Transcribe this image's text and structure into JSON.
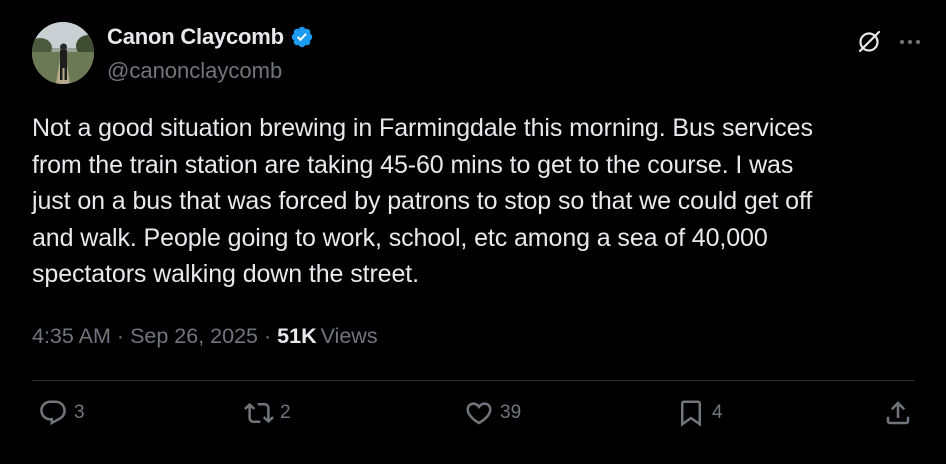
{
  "author": {
    "display_name": "Canon Claycomb",
    "handle": "@canonclaycomb",
    "verified": true
  },
  "tweet": {
    "text": "Not a good situation brewing in Farmingdale this morning. Bus services\nfrom the train station are taking 45-60 mins to get to the course. I was\njust on a bus that was forced by patrons to stop so that we could get off\nand walk. People going to work, school, etc among a sea of 40,000\nspectators walking down the street."
  },
  "meta": {
    "time": "4:35 AM",
    "date": "Sep 26, 2025",
    "separator": "·",
    "views_count": "51K",
    "views_label": "Views"
  },
  "actions": {
    "replies": "3",
    "reposts": "2",
    "likes": "39",
    "bookmarks": "4"
  },
  "icons": {
    "verified": "verified-badge-icon",
    "grok": "grok-icon",
    "more": "more-icon",
    "reply": "reply-icon",
    "repost": "repost-icon",
    "like": "heart-icon",
    "bookmark": "bookmark-icon",
    "share": "share-icon"
  },
  "colors": {
    "background": "#000000",
    "text": "#e7e9ea",
    "secondary_text": "#71767b",
    "verified": "#1d9bf0"
  }
}
